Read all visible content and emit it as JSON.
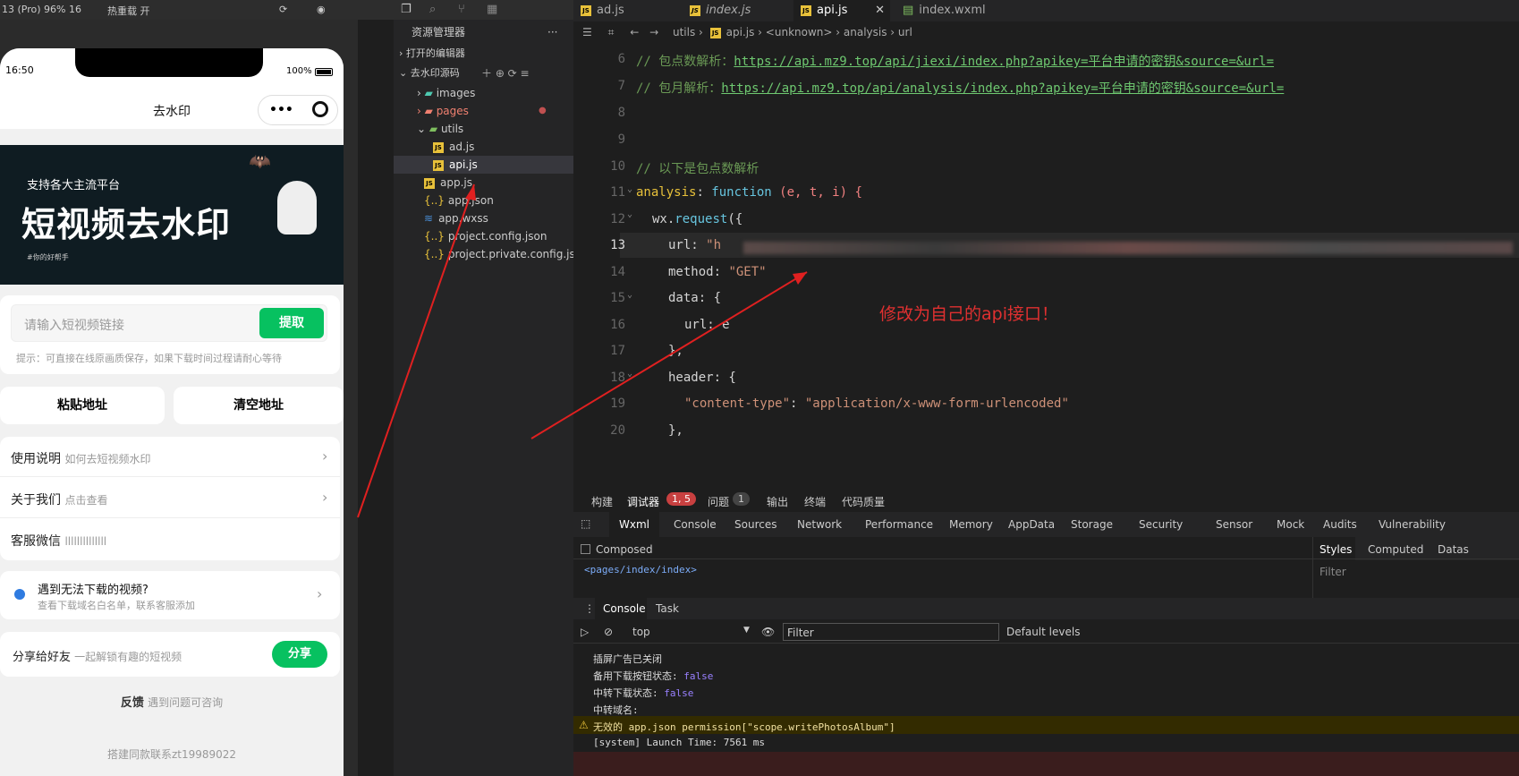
{
  "sim": {
    "device": "13 (Pro) 96% 16",
    "hotreload": "热重载 开",
    "time": "16:50",
    "battery": "100%",
    "title": "去水印",
    "banner_sub": "支持各大主流平台",
    "banner_main": "短视频去水印",
    "banner_tag": "#你的好帮手",
    "input_placeholder": "请输入短视频链接",
    "extract": "提取",
    "tip": "提示：可直接在线原画质保存，如果下载时间过程请耐心等待",
    "paste": "粘贴地址",
    "clear": "清空地址",
    "menu": [
      {
        "label": "使用说明",
        "sub": "如何去短视频水印"
      },
      {
        "label": "关于我们",
        "sub": "点击查看"
      },
      {
        "label": "客服微信",
        "sub": "llllllllllllll"
      }
    ],
    "notice_title": "遇到无法下载的视频?",
    "notice_sub": "查看下载域名白名单，联系客服添加",
    "share_label": "分享给好友",
    "share_sub": "一起解锁有趣的短视频",
    "share_btn": "分享",
    "feedback": "反馈",
    "feedback_sub": "遇到问题可咨询",
    "footer": "搭建同款联系zt19989022"
  },
  "explorer": {
    "title": "资源管理器",
    "open_editors": "打开的编辑器",
    "project": "去水印源码",
    "items": [
      "images",
      "pages",
      "utils",
      "ad.js",
      "api.js",
      "app.js",
      "app.json",
      "app.wxss",
      "project.config.json",
      "project.private.config.js..."
    ]
  },
  "tabs": [
    "ad.js",
    "index.js",
    "api.js",
    "index.wxml"
  ],
  "breadcrumb": [
    "utils",
    "api.js",
    "<unknown>",
    "analysis",
    "url"
  ],
  "code": {
    "l6_comment": "// 包点数解析：",
    "l6_url": "https://api.mz9.top/api/jiexi/index.php?apikey=平台申请的密钥&source=&url=",
    "l7_comment": "// 包月解析：",
    "l7_url": "https://api.mz9.top/api/analysis/index.php?apikey=平台申请的密钥&source=&url=",
    "l10": "// 以下是包点数解析",
    "l11_name": "analysis",
    "l11_kw": "function",
    "l11_args": "(e, t, i) {",
    "l12_obj": "wx",
    "l12_fn": "request",
    "l13_key": "url:",
    "l13_val": "\"h",
    "l14_key": "method:",
    "l14_val": "\"GET\"",
    "l15": "data: {",
    "l16": "url: e",
    "l17": "},",
    "l18": "header: {",
    "l19_key": "\"content-type\"",
    "l19_val": "\"application/x-www-form-urlencoded\"",
    "l20": "},",
    "lines": [
      "6",
      "7",
      "8",
      "9",
      "10",
      "11",
      "12",
      "13",
      "14",
      "15",
      "16",
      "17",
      "18",
      "19",
      "20"
    ]
  },
  "annotation": "修改为自己的api接口！",
  "bottom_tabs": [
    "构建",
    "调试器",
    "1, 5",
    "问题",
    "1",
    "输出",
    "终端",
    "代码质量"
  ],
  "devtools_tabs": [
    "Wxml",
    "Console",
    "Sources",
    "Network",
    "Performance",
    "Memory",
    "AppData",
    "Storage",
    "Security",
    "Sensor",
    "Mock",
    "Audits",
    "Vulnerability"
  ],
  "composed": "Composed",
  "styles_tabs": [
    "Styles",
    "Computed",
    "Datas"
  ],
  "filter": "Filter",
  "wxml_path": "<pages/index/index>",
  "console_tabs": [
    "Console",
    "Task"
  ],
  "context": "top",
  "default_levels": "Default levels",
  "console": {
    "l1": "插屏广告已关闭",
    "l2": "备用下载按钮状态:",
    "l3": "中转下载状态:",
    "bool": "false",
    "l4": "中转域名:",
    "warn": "无效的 app.json permission[\"scope.writePhotosAlbum\"]",
    "launch": "[system] Launch Time: 7561 ms"
  }
}
